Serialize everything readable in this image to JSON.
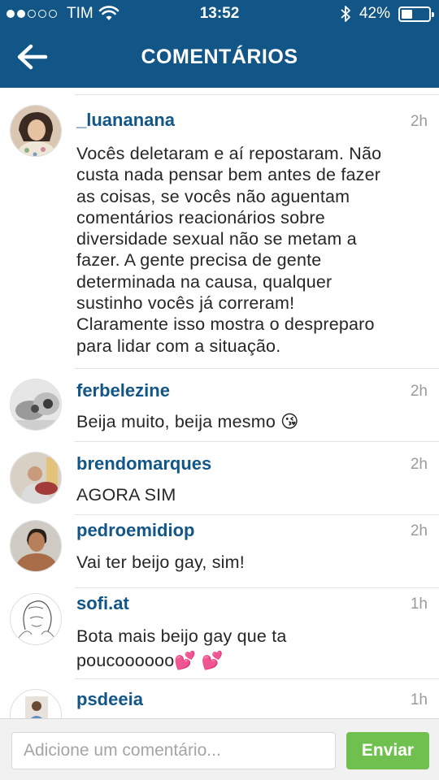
{
  "status_bar": {
    "carrier": "TIM",
    "time": "13:52",
    "battery": "42%",
    "battery_level": 0.42,
    "signal_dots_filled": 2,
    "signal_dots_total": 5,
    "icons": [
      "wifi-icon",
      "bluetooth-icon",
      "battery-icon"
    ]
  },
  "header": {
    "title": "COMENTÁRIOS",
    "back_icon": "back-arrow-icon",
    "background": "#125688"
  },
  "comments": [
    {
      "username": "_luananana",
      "time": "2h",
      "lines": [
        "Vocês deletaram e aí repostaram. Não",
        "custa nada pensar bem antes de fazer",
        "as coisas, se vocês não aguentam",
        "comentários reacionários sobre",
        "diversidade sexual não se metam a",
        "fazer. A gente precisa de gente",
        "determinada na causa,  qualquer",
        "sustinho vocês já correram!",
        "Claramente isso mostra o despreparo",
        "para lidar com a situação."
      ]
    },
    {
      "username": "ferbelezine",
      "time": "2h",
      "lines": [
        "Beija muito, beija mesmo 😘"
      ]
    },
    {
      "username": "brendomarques",
      "time": "2h",
      "lines": [
        "AGORA SIM"
      ]
    },
    {
      "username": "pedroemidiop",
      "time": "2h",
      "lines": [
        "Vai ter beijo gay, sim!"
      ]
    },
    {
      "username": "sofi.at",
      "time": "1h",
      "lines": [
        "Bota mais beijo gay que ta",
        "poucoooooo💕 💕"
      ]
    },
    {
      "username": "psdeeia",
      "time": "1h",
      "lines": []
    }
  ],
  "composer": {
    "placeholder": "Adicione um comentário...",
    "value": "",
    "send_label": "Enviar",
    "send_color": "#70c050"
  }
}
